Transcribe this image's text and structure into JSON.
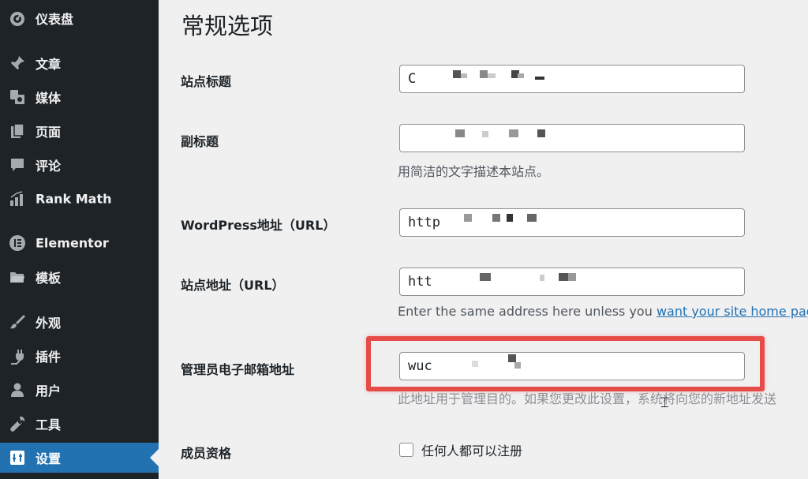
{
  "sidebar": {
    "items": [
      {
        "label": "仪表盘",
        "icon": "dashboard-icon"
      },
      {
        "label": "文章",
        "icon": "pin-icon"
      },
      {
        "label": "媒体",
        "icon": "media-icon"
      },
      {
        "label": "页面",
        "icon": "page-icon"
      },
      {
        "label": "评论",
        "icon": "comment-icon"
      },
      {
        "label": "Rank Math",
        "icon": "rank-math-icon"
      },
      {
        "label": "Elementor",
        "icon": "elementor-icon"
      },
      {
        "label": "模板",
        "icon": "folder-icon"
      },
      {
        "label": "外观",
        "icon": "brush-icon"
      },
      {
        "label": "插件",
        "icon": "plugin-icon"
      },
      {
        "label": "用户",
        "icon": "user-icon"
      },
      {
        "label": "工具",
        "icon": "wrench-icon"
      },
      {
        "label": "设置",
        "icon": "settings-icon",
        "active": true
      }
    ],
    "active_color": "#2271b1"
  },
  "main": {
    "title": "常规选项",
    "fields": {
      "site_title": {
        "label": "站点标题",
        "value": "C"
      },
      "tagline": {
        "label": "副标题",
        "value": "",
        "description": "用简洁的文字描述本站点。"
      },
      "wp_address": {
        "label": "WordPress地址（URL）",
        "value": "http"
      },
      "site_address": {
        "label": "站点地址（URL）",
        "value": "htt",
        "description_prefix": "Enter the same address here unless you ",
        "description_link": "want your site home pag"
      },
      "admin_email": {
        "label": "管理员电子邮箱地址",
        "value": "wuc",
        "description": "此地址用于管理目的。如果您更改此设置，系统将向您的新地址发送"
      },
      "membership": {
        "label": "成员资格",
        "checkbox_label": "任何人都可以注册"
      }
    },
    "highlight_color": "#e54b47"
  }
}
